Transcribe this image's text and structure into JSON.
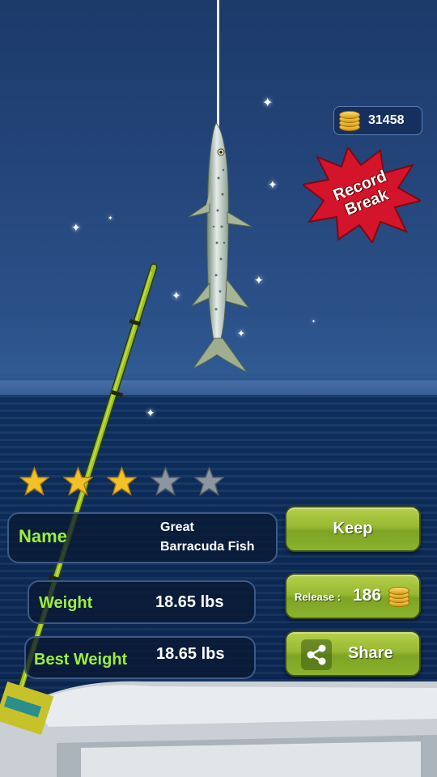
{
  "hud": {
    "coins": "31458",
    "coin_icon": "coin-stack-icon"
  },
  "badge": {
    "line1": "Record",
    "line2": "Break"
  },
  "rating": {
    "stars_filled": 3,
    "stars_total": 5
  },
  "fish_info": {
    "name_label": "Name",
    "name_line1": "Great",
    "name_line2": "Barracuda Fish",
    "weight_label": "Weight",
    "weight_value": "18.65 lbs",
    "best_weight_label": "Best Weight",
    "best_weight_value": "18.65 lbs"
  },
  "buttons": {
    "keep_label": "Keep",
    "release_prefix": "Release :",
    "release_value": "186",
    "share_label": "Share"
  },
  "colors": {
    "accent_green": "#9af03c",
    "button_green": "#97b933",
    "record_red": "#d4142a"
  }
}
